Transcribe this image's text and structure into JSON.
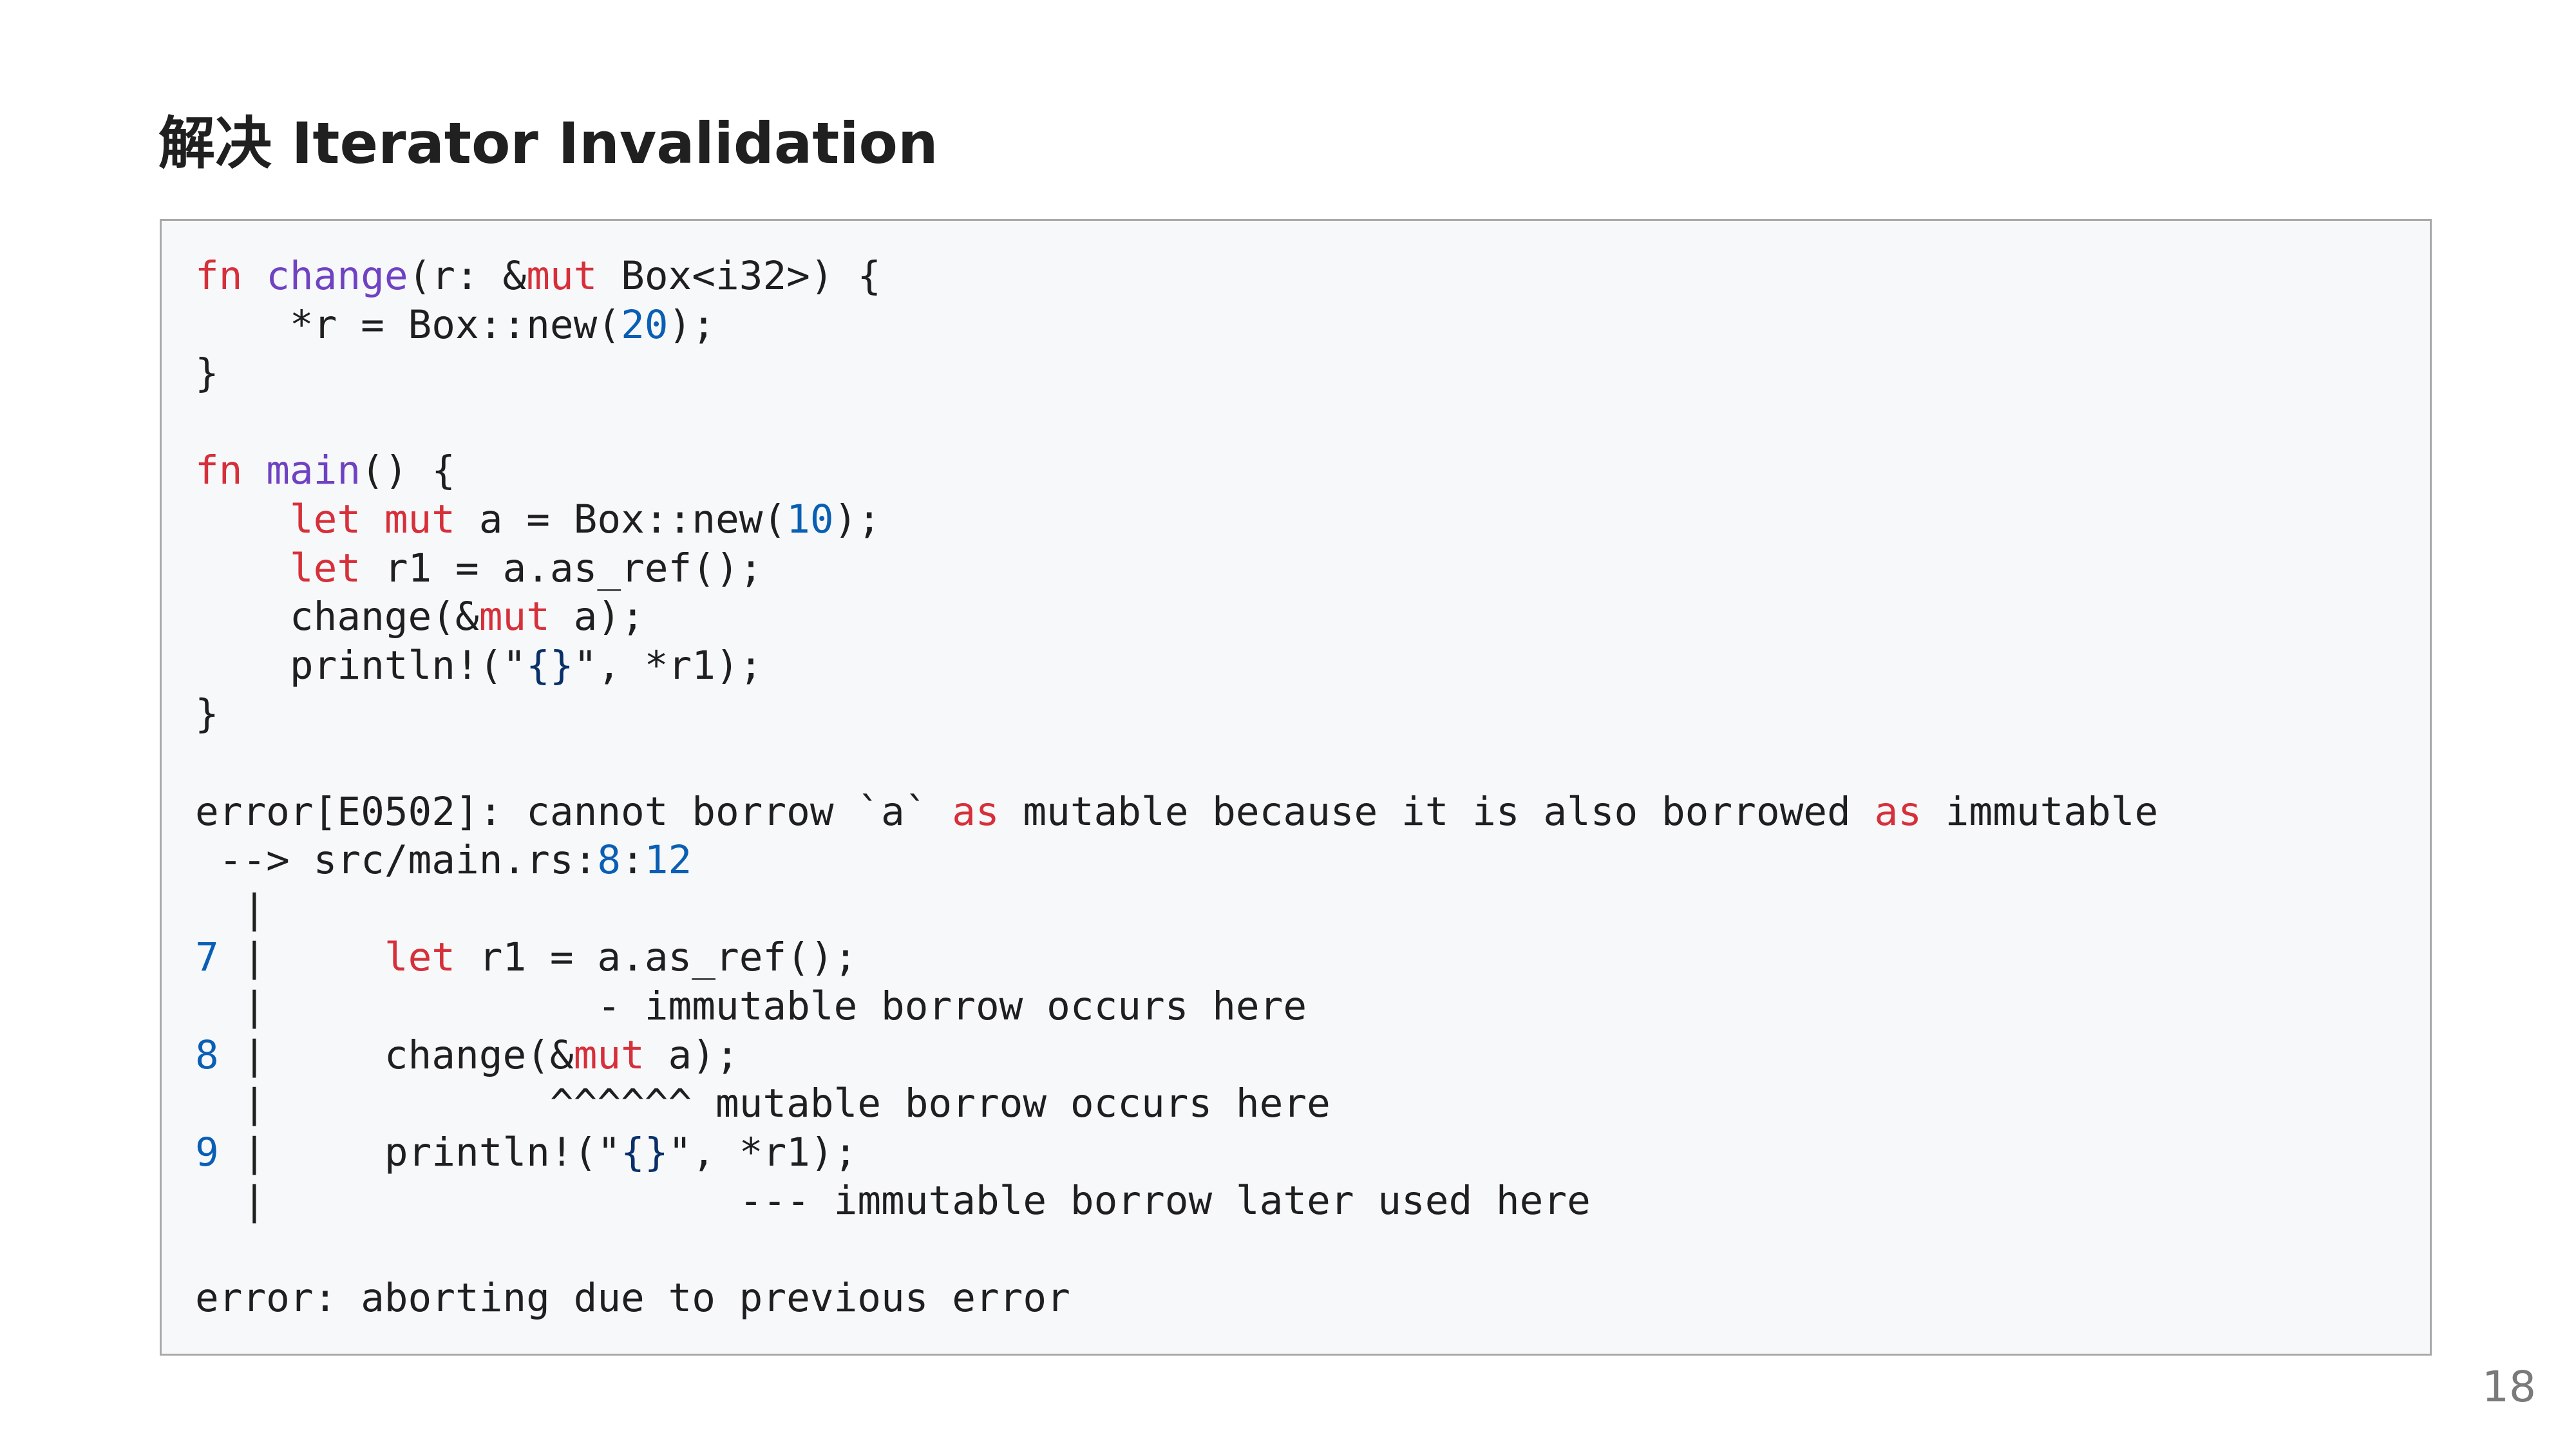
{
  "slide": {
    "title": "解决 Iterator Invalidation",
    "page_number": "18"
  },
  "code": {
    "l1": {
      "kw_fn": "fn",
      "sp1": " ",
      "fname": "change",
      "rest1": "(r: &",
      "kw_mut": "mut",
      "rest2": " Box<i32>) {"
    },
    "l2": {
      "pre": "    *r = Box::new(",
      "num": "20",
      "post": ");"
    },
    "l3": {
      "text": "}"
    },
    "l5": {
      "kw_fn": "fn",
      "sp1": " ",
      "fname": "main",
      "rest": "() {"
    },
    "l6": {
      "indent": "    ",
      "kw_let": "let",
      "sp1": " ",
      "kw_mut": "mut",
      "pre": " a = Box::new(",
      "num": "10",
      "post": ");"
    },
    "l7": {
      "indent": "    ",
      "kw_let": "let",
      "rest": " r1 = a.as_ref();"
    },
    "l8": {
      "pre": "    change(&",
      "kw_mut": "mut",
      "post": " a);"
    },
    "l9": {
      "pre": "    println!(\"",
      "fmt": "{}",
      "post": "\", *r1);"
    },
    "l10": {
      "text": "}"
    },
    "l12": {
      "pre": "error[E0502]: cannot borrow `a` ",
      "kw_as1": "as",
      "mid": " mutable because it is also borrowed ",
      "kw_as2": "as",
      "post": " immutable"
    },
    "l13": {
      "pre": " --> src/main.rs:",
      "line": "8",
      "colon": ":",
      "col": "12"
    },
    "l14": {
      "pre": "  ",
      "pipe": "|"
    },
    "l15": {
      "num": "7",
      "sp": " ",
      "pipe": "|",
      "indent": "     ",
      "kw_let": "let",
      "rest": " r1 = a.as_ref();"
    },
    "l16": {
      "pre": "  ",
      "pipe": "|",
      "rest": "              - immutable borrow occurs here"
    },
    "l17": {
      "num": "8",
      "sp": " ",
      "pipe": "|",
      "pre": "     change(&",
      "kw_mut": "mut",
      "post": " a);"
    },
    "l18": {
      "pre": "  ",
      "pipe": "|",
      "rest": "            ^^^^^^ mutable borrow occurs here"
    },
    "l19": {
      "num": "9",
      "sp": " ",
      "pipe": "|",
      "pre": "     println!(\"",
      "fmt": "{}",
      "post": "\", *r1);"
    },
    "l20": {
      "pre": "  ",
      "pipe": "|",
      "rest": "                    --- immutable borrow later used here"
    },
    "l22": {
      "text": "error: aborting due to previous error"
    }
  }
}
